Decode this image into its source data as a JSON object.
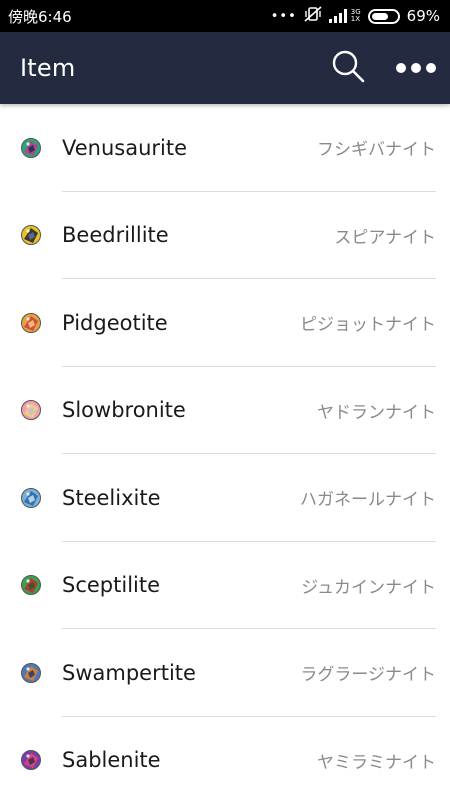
{
  "status_bar": {
    "time": "傍晚6:46",
    "more_dots": "•••",
    "network_top": "3G",
    "network_bottom": "1X",
    "battery_percent": "69%",
    "battery_level": 0.69
  },
  "app_bar": {
    "title": "Item",
    "search_icon": "search-icon",
    "more_icon": "more-icon"
  },
  "items": [
    {
      "name": "Venusaurite",
      "jp": "フシギバナイト",
      "icon_colors": [
        "#2aa57a",
        "#c23a8a",
        "#1b2a5a"
      ]
    },
    {
      "name": "Beedrillite",
      "jp": "スピアナイト",
      "icon_colors": [
        "#e6c22a",
        "#2a2a2a",
        "#6b6b9a"
      ]
    },
    {
      "name": "Pidgeotite",
      "jp": "ピジョットナイト",
      "icon_colors": [
        "#e8a23a",
        "#d2404a",
        "#f4d07a"
      ]
    },
    {
      "name": "Slowbronite",
      "jp": "ヤドランナイト",
      "icon_colors": [
        "#f0a0b0",
        "#f0d080",
        "#c0c0d0"
      ]
    },
    {
      "name": "Steelixite",
      "jp": "ハガネールナイト",
      "icon_colors": [
        "#7ab0d8",
        "#2a6ab0",
        "#d0e0f0"
      ]
    },
    {
      "name": "Sceptilite",
      "jp": "ジュカインナイト",
      "icon_colors": [
        "#3aa050",
        "#c03030",
        "#2a5a2a"
      ]
    },
    {
      "name": "Swampertite",
      "jp": "ラグラージナイト",
      "icon_colors": [
        "#4a7ab8",
        "#e08030",
        "#2a3a6a"
      ]
    },
    {
      "name": "Sablenite",
      "jp": "ヤミラミナイト",
      "icon_colors": [
        "#7a3ab0",
        "#e04a6a",
        "#3a2a5a"
      ]
    }
  ]
}
